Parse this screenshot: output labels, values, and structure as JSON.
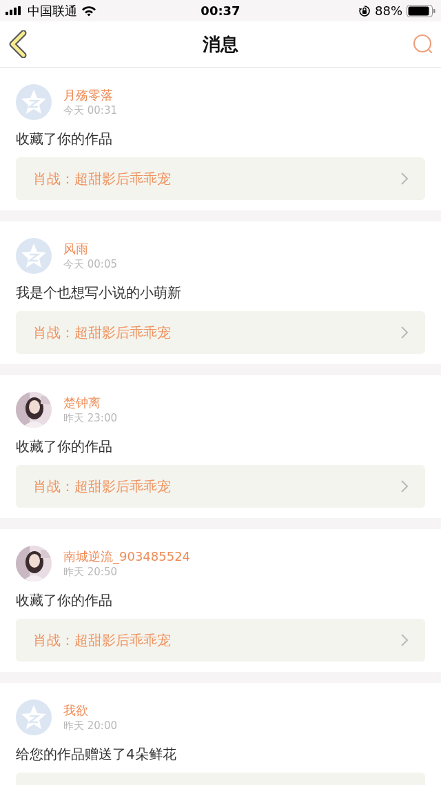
{
  "status_bar": {
    "carrier": "中国联通",
    "time": "00:37",
    "battery": "88%"
  },
  "nav": {
    "title": "消息"
  },
  "messages": [
    {
      "name": "月殇零落",
      "time": "今天 00:31",
      "avatar": {
        "kind": "default"
      },
      "text": "收藏了你的作品",
      "link": "肖战：超甜影后乖乖宠"
    },
    {
      "name": "风雨",
      "time": "今天 00:05",
      "avatar": {
        "kind": "default"
      },
      "text": "我是个也想写小说的小萌新",
      "link": "肖战：超甜影后乖乖宠"
    },
    {
      "name": "楚钟离",
      "time": "昨天 23:00",
      "text": "收藏了你的作品",
      "link": "肖战：超甜影后乖乖宠"
    },
    {
      "name": "南城逆流_903485524",
      "time": "昨天 20:50",
      "text": "收藏了你的作品",
      "link": "肖战：超甜影后乖乖宠"
    },
    {
      "name": "我欲",
      "time": "昨天 20:00",
      "avatar": {
        "kind": "default"
      },
      "text": "给您的作品赠送了4朵鲜花"
    }
  ]
}
